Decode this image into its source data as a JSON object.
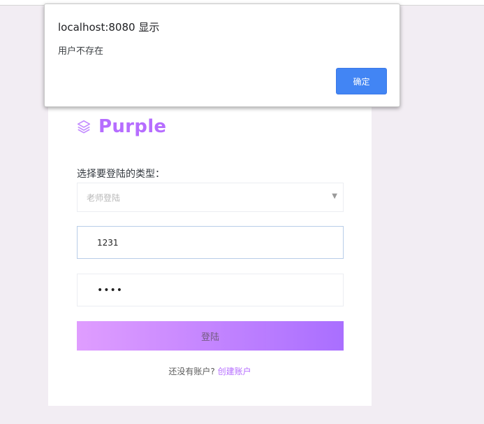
{
  "brand": {
    "name": "Purple",
    "icon": "layers-icon",
    "color": "#b66dff"
  },
  "form": {
    "type_label": "选择要登陆的类型：",
    "type_select_value": "老师登陆",
    "username_value": "1231",
    "password_value": "••••",
    "login_label": "登陆",
    "signup_text": "还没有账户?",
    "signup_link": "创建账户"
  },
  "alert": {
    "title": "localhost:8080 显示",
    "message": "用户不存在",
    "ok_label": "确定",
    "ok_color": "#4285f4"
  }
}
